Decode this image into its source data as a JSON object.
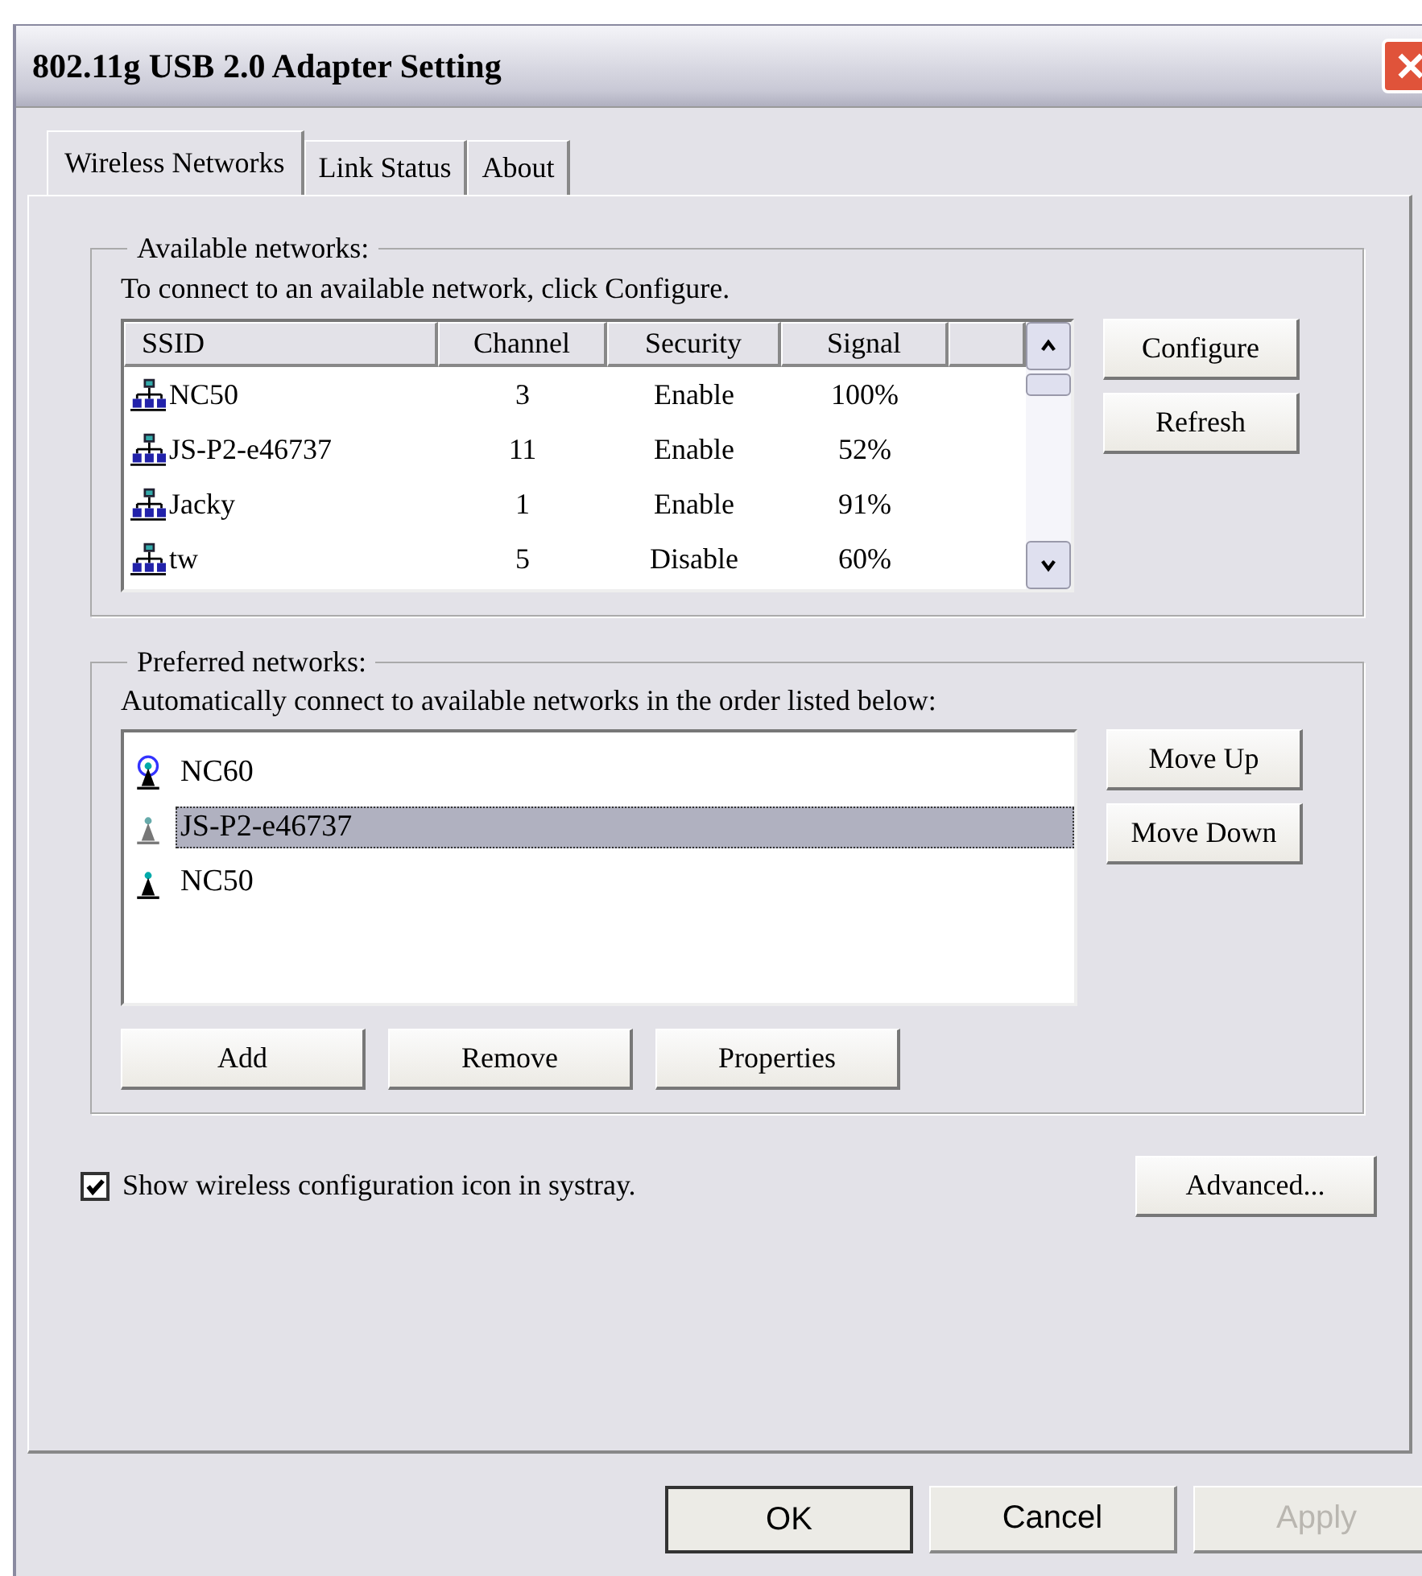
{
  "window": {
    "title": "802.11g USB 2.0 Adapter Setting"
  },
  "tabs": [
    {
      "label": "Wireless Networks",
      "selected": true
    },
    {
      "label": "Link Status",
      "selected": false
    },
    {
      "label": "About",
      "selected": false
    }
  ],
  "available": {
    "legend": "Available networks:",
    "hint": "To connect to an available network, click Configure.",
    "columns": [
      "SSID",
      "Channel",
      "Security",
      "Signal"
    ],
    "rows": [
      {
        "ssid": "NC50",
        "channel": "3",
        "security": "Enable",
        "signal": "100%"
      },
      {
        "ssid": "JS-P2-e46737",
        "channel": "11",
        "security": "Enable",
        "signal": "52%"
      },
      {
        "ssid": "Jacky",
        "channel": "1",
        "security": "Enable",
        "signal": "91%"
      },
      {
        "ssid": "tw",
        "channel": "5",
        "security": "Disable",
        "signal": "60%"
      }
    ],
    "buttons": [
      "Configure",
      "Refresh"
    ]
  },
  "preferred": {
    "legend": "Preferred networks:",
    "hint": "Automatically connect to available networks in the order listed below:",
    "items": [
      {
        "name": "NC60",
        "kind": "connected",
        "selected": false
      },
      {
        "name": "JS-P2-e46737",
        "kind": "unavailable",
        "selected": true
      },
      {
        "name": "NC50",
        "kind": "available",
        "selected": false
      }
    ],
    "side_buttons": [
      "Move Up",
      "Move Down"
    ],
    "buttons": [
      "Add",
      "Remove",
      "Properties"
    ]
  },
  "systray": {
    "label": "Show wireless configuration icon in systray.",
    "checked": true
  },
  "advanced_button": "Advanced...",
  "dialog_buttons": [
    {
      "label": "OK",
      "default": true,
      "disabled": false
    },
    {
      "label": "Cancel",
      "default": false,
      "disabled": false
    },
    {
      "label": "Apply",
      "default": false,
      "disabled": true
    }
  ]
}
